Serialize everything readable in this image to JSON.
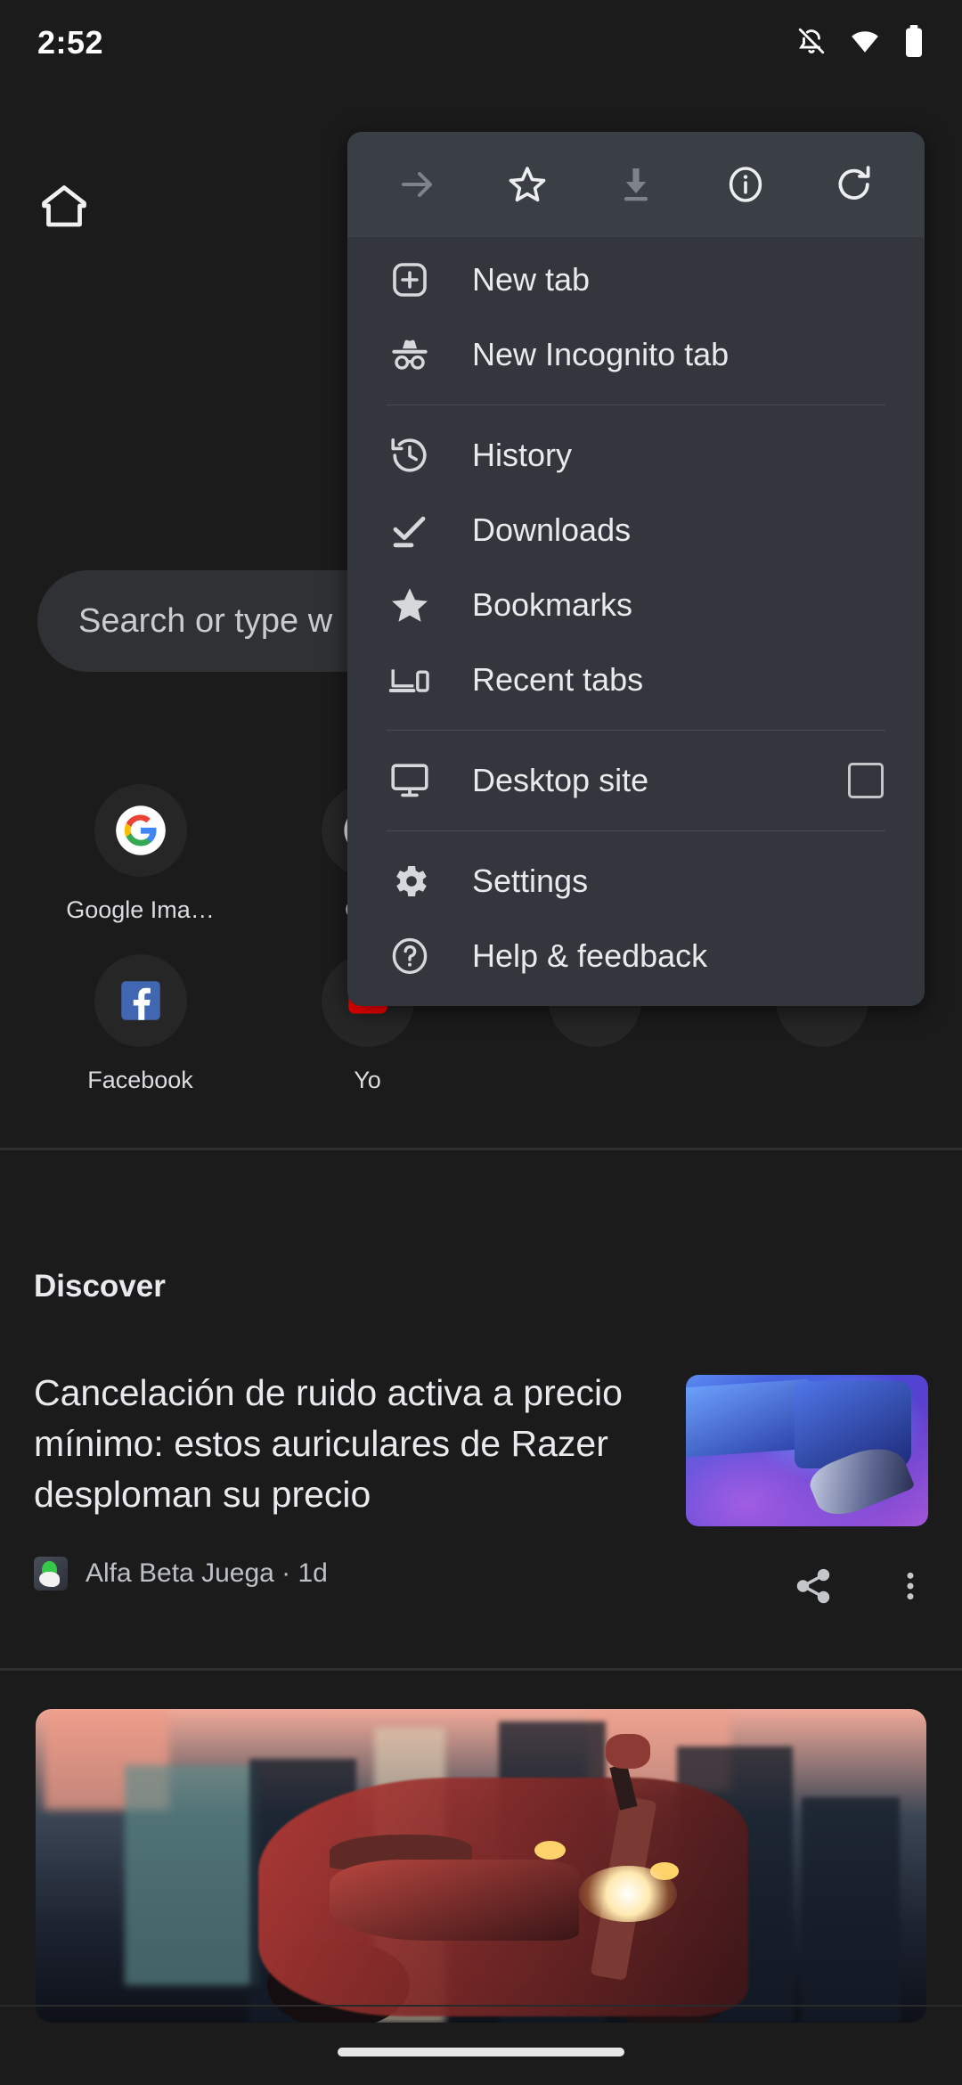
{
  "statusbar": {
    "time": "2:52",
    "icons": [
      {
        "name": "notifications-off-icon"
      },
      {
        "name": "wifi-icon"
      },
      {
        "name": "battery-icon"
      }
    ]
  },
  "newtab": {
    "home_icon": "home-icon",
    "logo": "google-logo",
    "search": {
      "placeholder": "Search or type web address",
      "visible_text": "Search or type w"
    },
    "shortcuts": [
      {
        "label": "Google Ima…",
        "icon": "google-icon"
      },
      {
        "label": "Goo",
        "icon": "google-icon"
      },
      {
        "label": "",
        "icon": "shortcut-icon"
      },
      {
        "label": "",
        "icon": "shortcut-icon"
      },
      {
        "label": "Facebook",
        "icon": "facebook-icon"
      },
      {
        "label": "Yo",
        "icon": "youtube-icon"
      },
      {
        "label": "",
        "icon": "shortcut-icon"
      },
      {
        "label": "",
        "icon": "shortcut-icon"
      }
    ]
  },
  "feed": {
    "section_title": "Discover",
    "articles": [
      {
        "title": "Cancelación de ruido activa a precio mínimo: estos auriculares de Razer desploman su precio",
        "source": "Alfa Beta Juega · 1d",
        "thumbnail": "razer-earbuds-image",
        "share_icon": "share-icon",
        "more_icon": "more-vertical-icon"
      },
      {
        "title": "",
        "source": "",
        "thumbnail": "motorcycle-city-image"
      }
    ]
  },
  "menu": {
    "toolbar": [
      {
        "name": "forward-icon",
        "label": "Forward",
        "disabled": true
      },
      {
        "name": "bookmark-star-icon",
        "label": "Bookmark",
        "disabled": false
      },
      {
        "name": "download-icon",
        "label": "Download",
        "disabled": true
      },
      {
        "name": "page-info-icon",
        "label": "Page info",
        "disabled": false
      },
      {
        "name": "reload-icon",
        "label": "Reload",
        "disabled": false
      }
    ],
    "items": [
      {
        "label": "New tab",
        "icon": "new-tab-icon",
        "type": "item"
      },
      {
        "label": "New Incognito tab",
        "icon": "incognito-icon",
        "type": "item"
      },
      {
        "type": "separator"
      },
      {
        "label": "History",
        "icon": "history-icon",
        "type": "item"
      },
      {
        "label": "Downloads",
        "icon": "downloads-icon",
        "type": "item"
      },
      {
        "label": "Bookmarks",
        "icon": "bookmarks-star-icon",
        "type": "item"
      },
      {
        "label": "Recent tabs",
        "icon": "recent-tabs-icon",
        "type": "item"
      },
      {
        "type": "separator"
      },
      {
        "label": "Desktop site",
        "icon": "desktop-site-icon",
        "type": "checkbox",
        "checked": false
      },
      {
        "type": "separator"
      },
      {
        "label": "Settings",
        "icon": "settings-gear-icon",
        "type": "item"
      },
      {
        "label": "Help & feedback",
        "icon": "help-circle-icon",
        "type": "item"
      }
    ]
  },
  "colors": {
    "page_background": "#1b1b1b",
    "menu_background": "#33373d",
    "menu_toolbar_background": "#3a3f46",
    "text_primary": "#e9eaec",
    "text_secondary": "#bdc1c6",
    "search_background": "#2f3134",
    "divider": "#474c53"
  }
}
